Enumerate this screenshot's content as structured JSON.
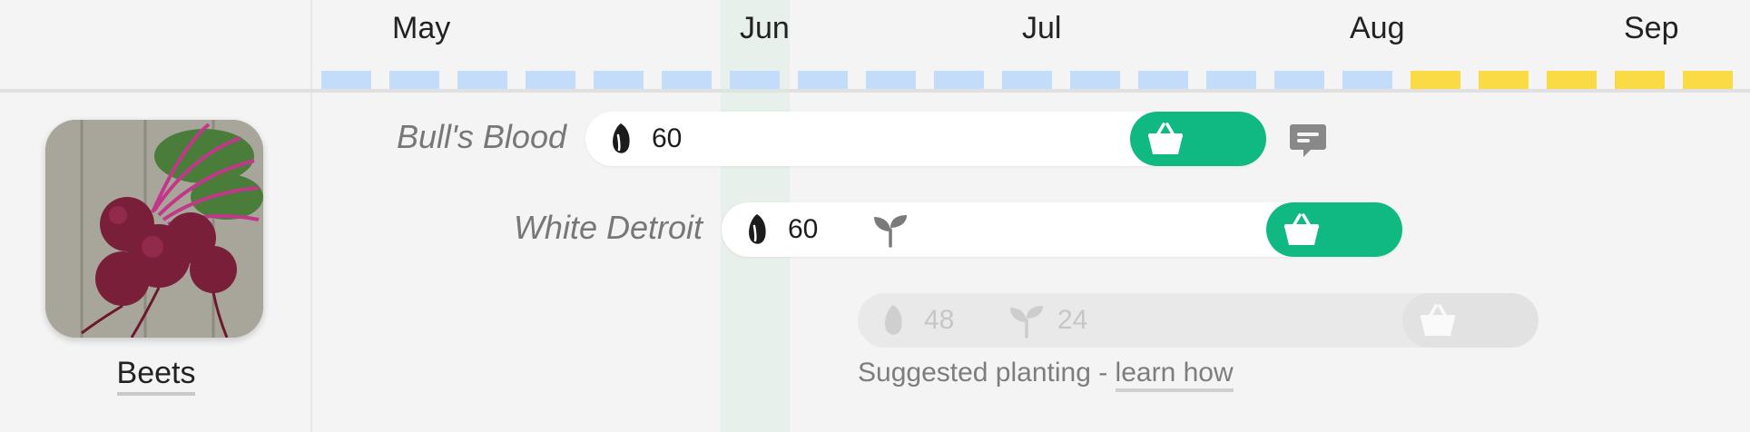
{
  "timeline": {
    "months": [
      "May",
      "Jun",
      "Jul",
      "Aug",
      "Sep"
    ],
    "week_colors": {
      "sow": "#c3dcfa",
      "harvest": "#fbdb45"
    }
  },
  "crop": {
    "name": "Beets",
    "photo_icon": "beets-photo"
  },
  "varieties": [
    {
      "name": "Bull's Blood",
      "seed_count": "60"
    },
    {
      "name": "White Detroit",
      "seed_count": "60"
    }
  ],
  "suggested": {
    "seed_count": "48",
    "sprout_count": "24",
    "text": "Suggested planting - ",
    "link": "learn how"
  },
  "colors": {
    "accent": "#10b981",
    "label_gray": "#777777"
  },
  "icons": {
    "seed": "seed-icon",
    "sprout": "sprout-icon",
    "basket": "basket-icon",
    "note": "comment-icon"
  }
}
